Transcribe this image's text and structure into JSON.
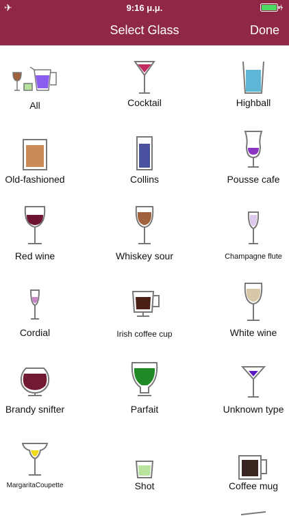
{
  "status": {
    "time": "9:16 μ.μ."
  },
  "nav": {
    "title": "Select Glass",
    "done": "Done"
  },
  "glasses": [
    {
      "label": "All",
      "name": "all"
    },
    {
      "label": "Cocktail",
      "name": "cocktail"
    },
    {
      "label": "Highball",
      "name": "highball"
    },
    {
      "label": "Old-fashioned",
      "name": "old-fashioned"
    },
    {
      "label": "Collins",
      "name": "collins"
    },
    {
      "label": "Pousse cafe",
      "name": "pousse-cafe"
    },
    {
      "label": "Red wine",
      "name": "red-wine"
    },
    {
      "label": "Whiskey sour",
      "name": "whiskey-sour"
    },
    {
      "label": "Champagne flute",
      "name": "champagne-flute"
    },
    {
      "label": "Cordial",
      "name": "cordial"
    },
    {
      "label": "Irish coffee cup",
      "name": "irish-coffee-cup"
    },
    {
      "label": "White wine",
      "name": "white-wine"
    },
    {
      "label": "Brandy snifter",
      "name": "brandy-snifter"
    },
    {
      "label": "Parfait",
      "name": "parfait"
    },
    {
      "label": "Unknown  type",
      "name": "unknown-type"
    },
    {
      "label": "MargaritaCoupette",
      "name": "margarita-coupette"
    },
    {
      "label": "Shot",
      "name": "shot"
    },
    {
      "label": "Coffee mug",
      "name": "coffee-mug"
    }
  ],
  "colors": {
    "bar": "#8e2846",
    "cocktail": "#c22a62",
    "highball": "#5cb7d6",
    "old_fashioned": "#c98b58",
    "collins": "#4a52a0",
    "pousse_cafe": "#8b34c4",
    "red_wine": "#6e1433",
    "whiskey_sour": "#a0623c",
    "champagne": "#dec8ee",
    "cordial": "#c786c4",
    "irish_coffee": "#4a1f14",
    "white_wine": "#d8c8a8",
    "brandy": "#731a33",
    "parfait": "#1f8a25",
    "unknown": "#5a1ac0",
    "margarita": "#f2d81c",
    "shot": "#b7e39c",
    "coffee_mug": "#3b2520"
  }
}
